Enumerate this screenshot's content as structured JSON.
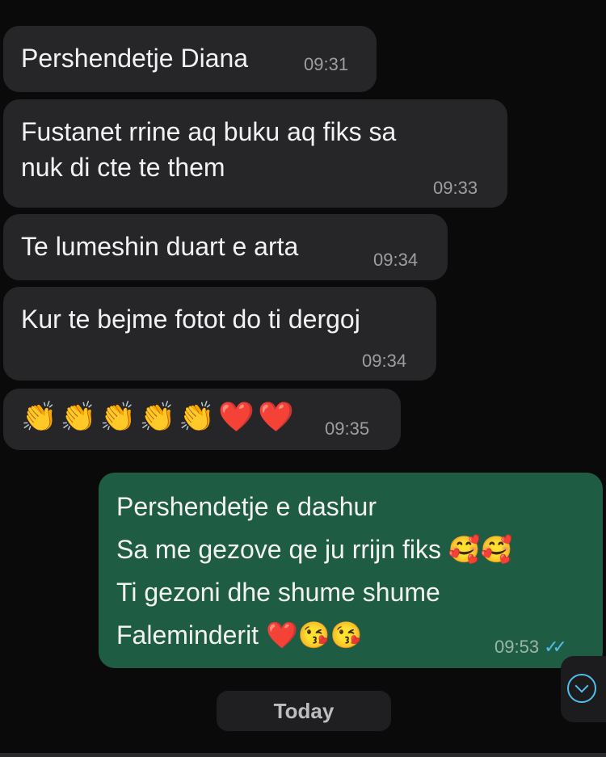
{
  "messages": [
    {
      "text": "Pershendetje Diana",
      "time": "09:31",
      "direction": "incoming"
    },
    {
      "text": "Fustanet rrine aq buku aq fiks sa\nnuk di cte te them",
      "time": "09:33",
      "direction": "incoming"
    },
    {
      "text": "Te lumeshin duart e arta",
      "time": "09:34",
      "direction": "incoming"
    },
    {
      "text": "Kur te bejme fotot do ti dergoj",
      "time": "09:34",
      "direction": "incoming"
    },
    {
      "text": "👏👏👏👏👏❤️❤️",
      "time": "09:35",
      "direction": "incoming"
    },
    {
      "text": "Pershendetje e dashur\nSa me gezove qe ju rrijn fiks 🥰🥰\nTi gezoni dhe shume shume\nFaleminderit ❤️😘😘",
      "time": "09:53",
      "direction": "outgoing",
      "status": "read"
    }
  ],
  "date_separator": "Today",
  "icons": {
    "read_receipt": "double-check-icon",
    "scroll_down": "chevron-down-circle-icon"
  },
  "colors": {
    "incoming_bubble": "#262628",
    "outgoing_bubble": "#1f5c44",
    "read_tick": "#53bdeb",
    "background": "#0a0a0a"
  }
}
